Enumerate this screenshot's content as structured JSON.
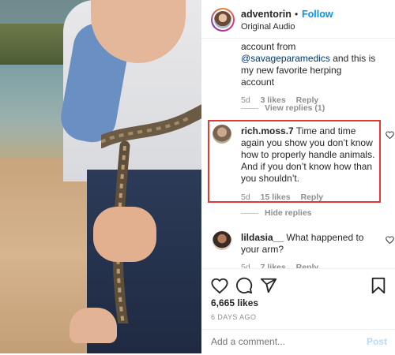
{
  "header": {
    "username": "adventorin",
    "separator": "•",
    "follow_label": "Follow",
    "audio_label": "Original Audio"
  },
  "comments": [
    {
      "text_before": "account from ",
      "mention": "@savageparamedics",
      "text_after": " and this is my new favorite herping account",
      "age": "5d",
      "likes": "3 likes",
      "reply_label": "Reply",
      "replies_toggle": "View replies (1)"
    },
    {
      "username": "rich.moss.7",
      "text": "Time and time again you show you don’t know how to properly handle animals. And if you don’t know how than you shouldn’t.",
      "age": "5d",
      "likes": "15 likes",
      "reply_label": "Reply",
      "replies_toggle": "Hide replies"
    },
    {
      "username": "lildasia__",
      "text": "What happened to your arm?",
      "age": "5d",
      "likes": "7 likes",
      "reply_label": "Reply"
    }
  ],
  "post": {
    "likes_count": "6,665 likes",
    "date": "6 DAYS AGO"
  },
  "add_comment": {
    "placeholder": "Add a comment...",
    "post_label": "Post"
  },
  "icons": {
    "like": "heart-icon",
    "comment": "comment-icon",
    "share": "share-icon",
    "save": "bookmark-icon"
  },
  "colors": {
    "follow": "#0095f6",
    "highlight_border": "#e23a32",
    "muted": "#8e8e8e"
  }
}
